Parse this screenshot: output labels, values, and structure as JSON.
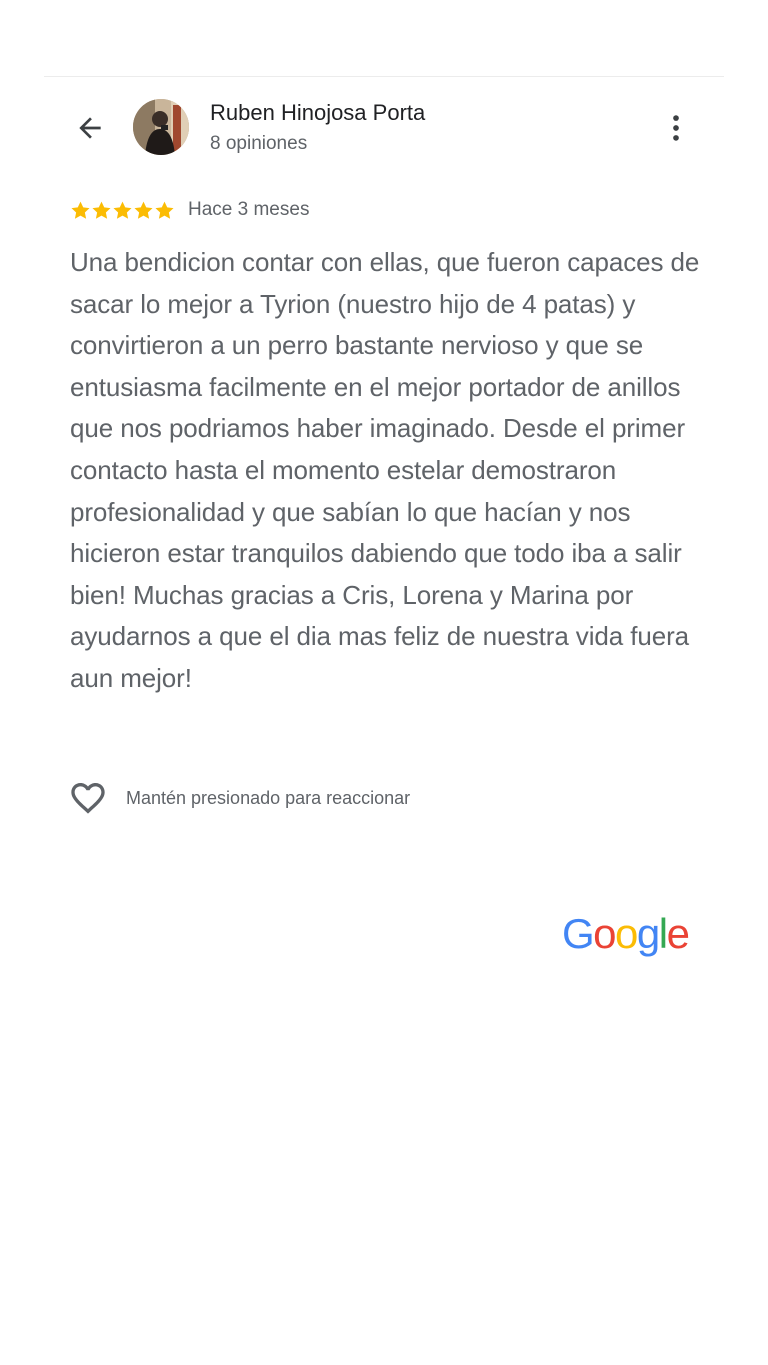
{
  "header": {
    "user_name": "Ruben Hinojosa Porta",
    "review_count": "8 opiniones"
  },
  "review": {
    "rating": 5,
    "max_rating": 5,
    "date": "Hace 3 meses",
    "text": "Una bendicion contar con ellas, que fueron capaces de sacar lo mejor a Tyrion (nuestro hijo de 4 patas) y convirtieron a un perro bastante nervioso y que se entusiasma facilmente en el mejor portador de anillos que nos podriamos haber imaginado. Desde el primer contacto hasta el momento estelar demostraron profesionalidad y que sabían lo que hacían y nos hicieron estar tranquilos dabiendo que todo iba a salir bien! Muchas gracias a Cris, Lorena y Marina por ayudarnos a que el dia mas feliz de nuestra vida fuera aun mejor!"
  },
  "reaction": {
    "hint": "Mantén presionado para reaccionar"
  },
  "footer": {
    "logo_text": "Google"
  },
  "icons": {
    "back": "arrow-back-icon",
    "more": "more-vert-icon",
    "star": "star-icon",
    "react": "heart-outline-icon"
  },
  "colors": {
    "star": "#fbbc04",
    "google_blue": "#4285f4",
    "google_red": "#ea4335",
    "google_yellow": "#fbbc05",
    "google_green": "#34a853",
    "text_primary": "#202124",
    "text_secondary": "#5f6368"
  }
}
